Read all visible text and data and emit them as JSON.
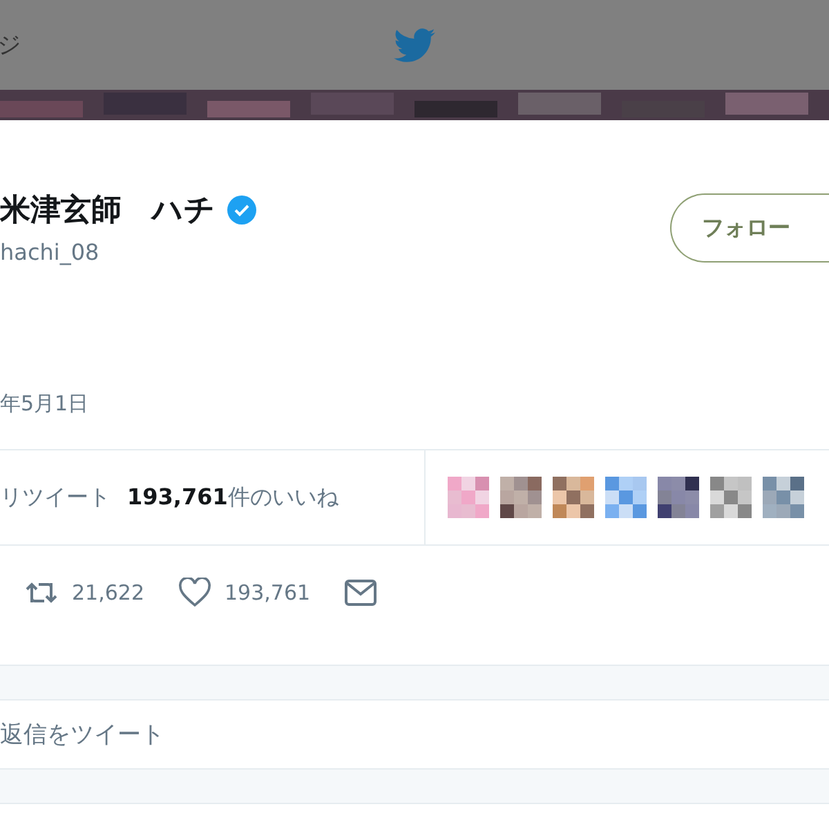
{
  "top_bar": {
    "page_title": "ジ"
  },
  "tweet": {
    "author_name": "米津玄師　ハチ",
    "verified": true,
    "handle": "hachi_08",
    "follow_button": "フォロー",
    "date": "年5月1日",
    "retweets_label": "リツイート",
    "likes_count": "193,761",
    "likes_label": "件のいいね",
    "actions": [
      {
        "kind": "retweet",
        "count": "21,622"
      },
      {
        "kind": "like",
        "count": "193,761"
      },
      {
        "kind": "message"
      }
    ]
  },
  "reply": {
    "placeholder": "返信をツイート"
  }
}
